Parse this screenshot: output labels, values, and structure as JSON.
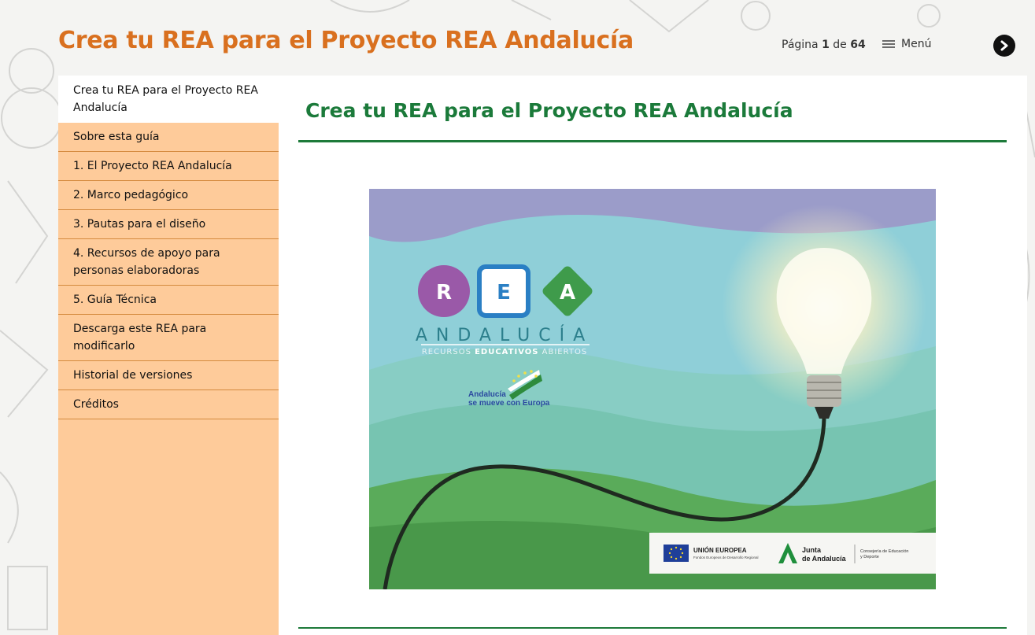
{
  "header": {
    "title": "Crea tu REA para el Proyecto REA Andalucía",
    "pager_prefix": "Página",
    "pager_current": "1",
    "pager_sep": "de",
    "pager_total": "64",
    "menu_label": "Menú",
    "next_icon": "chevron-right-icon"
  },
  "sidebar": {
    "items": [
      {
        "label": "Crea tu REA para el Proyecto REA Andalucía",
        "active": true
      },
      {
        "label": "Sobre esta guía"
      },
      {
        "label": "1. El Proyecto REA Andalucía"
      },
      {
        "label": "2. Marco pedagógico"
      },
      {
        "label": "3. Pautas para el diseño"
      },
      {
        "label": "4. Recursos de apoyo para personas elaboradoras"
      },
      {
        "label": "5. Guía Técnica"
      },
      {
        "label": "Descarga este REA para modificarlo"
      },
      {
        "label": "Historial de versiones"
      },
      {
        "label": "Créditos"
      }
    ]
  },
  "main": {
    "heading": "Crea tu REA para el Proyecto REA Andalucía",
    "cover": {
      "letters": [
        "R",
        "E",
        "A"
      ],
      "brand": "ANDALUCÍA",
      "tagline_pre": "RECURSOS ",
      "tagline_bold": "EDUCATIVOS",
      "tagline_post": " ABIERTOS",
      "andalucia_line1": "Andalucía",
      "andalucia_line2": "se mueve con Europa",
      "eu_title": "UNIÓN EUROPEA",
      "eu_sub": "Fondos Europeos de Desarrollo Regional",
      "junta_line1": "Junta",
      "junta_line2": "de Andalucía",
      "consejeria_line1": "Consejería de Educación",
      "consejeria_line2": "y Deporte"
    }
  },
  "colors": {
    "title_orange": "#d9701f",
    "heading_green": "#1b7a3a",
    "sidebar_bg": "#fecb9a",
    "r_circle": "#9a59a8",
    "e_square": "#2a7fc4",
    "a_diamond": "#3f9b4b"
  }
}
